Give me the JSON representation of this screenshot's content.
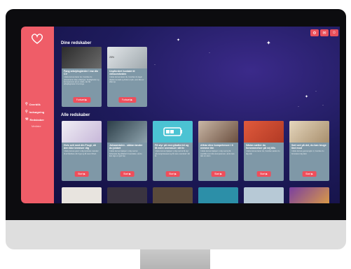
{
  "sidebar": {
    "items": [
      {
        "icon": "search-icon",
        "label": "Overblik"
      },
      {
        "icon": "search-icon",
        "label": "Indsøgning"
      },
      {
        "icon": "wrench-icon",
        "label": "Redskaber"
      }
    ],
    "sub_label": "Mediator"
  },
  "top_icons": [
    "gear-icon",
    "mail-icon",
    "user-icon"
  ],
  "sections": {
    "mine": "Dine redskaber",
    "all": "Alle redskaber"
  },
  "my_tools": [
    {
      "title": "Fang arbejdsglæder i mø din CV",
      "desc": "I dette kursus lærer du, hvordan du præsenterer dine erfaringer, færdigheder og kompetencer på en måde, der får arbejdsgiveren til at ringe.",
      "button": "Fortsæt ▶",
      "progress": "",
      "thumb": "#3a3a3a"
    },
    {
      "title": "Uopfordret kontakt til virksomheden",
      "desc": "I dette kursus lærer du, hvordan du tager direkte kontakt og finder et job, som ikke er slået op.",
      "button": "Fortsæt ▶",
      "progress": "25%",
      "thumb": "#cfd6da"
    }
  ],
  "all_tools": [
    {
      "title": "Hvis seit med din Frugt, så den ikke bremser dig",
      "desc": "I dette kursus giver vi dig konkrete metoder til at håndtere din frygt og få mere frihed.",
      "button": "Start ▶",
      "thumb": "#e6e1ee"
    },
    {
      "title": "Jobsamtalen - sådan lander du jobbet",
      "desc": "I dette kursus hjælper vi dig med at forberede dig effektivt til samtalen, så du kan sige en god rap.",
      "button": "Start ▶",
      "thumb": "#3c5563"
    },
    {
      "title": "Få styr på energibatteriet og få mere overskud i dit liv",
      "desc": "I dette kursus hjælper vi dig med at få styr på energiniveauet og få mere overskud i dit liv.",
      "button": "Start ▶",
      "thumb": "#4bc3d3"
    },
    {
      "title": "Afklar dine kompetencer i 6 nemme trin",
      "desc": "I dette kursus hjælper vi dig med at få overblik over dine kompetencer, så du kan tale om dem.",
      "button": "Start ▶",
      "thumb": "#8a6a58"
    },
    {
      "title": "Sådan sætter du fornemmelser på vej tills",
      "desc": "I dette kursus lærer du, hvordan sætter du dig mål.",
      "button": "Start ▶",
      "thumb": "#d0482f"
    },
    {
      "title": "Sæt ord på det, du kan bruge lind mod",
      "desc": "I dette kursus gennemgår vi, hvordan du formulerer dig klart.",
      "button": "Start ▶",
      "thumb": "#cbb79a"
    }
  ],
  "bottom_thumbs": [
    "#e8e4df",
    "#2d2b35",
    "#5a4a3a",
    "#2c8fa8",
    "#b7c9d6",
    "#4a8a7d"
  ],
  "colors": {
    "sidebar": "#ef5d68",
    "accent": "#ef4e5b",
    "card": "#7f98a7"
  }
}
